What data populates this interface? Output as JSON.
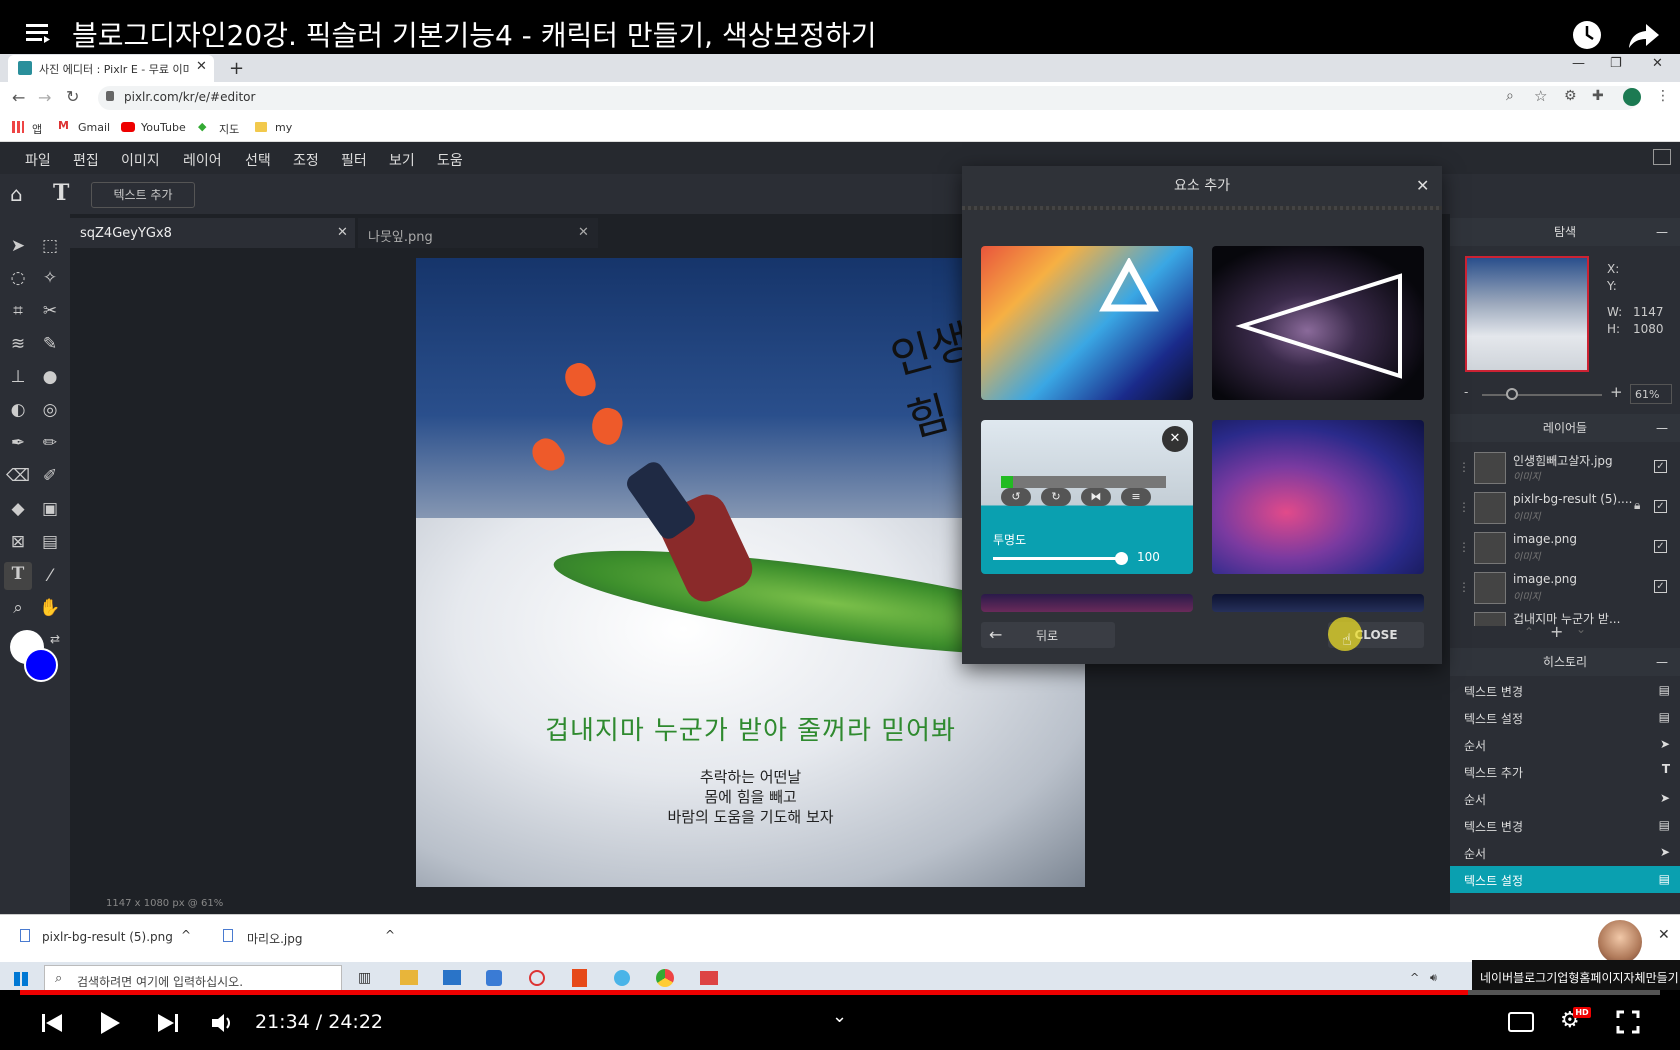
{
  "video": {
    "title": "블로그디자인20강. 픽슬러 기본기능4 - 캐릭터 만들기, 색상보정하기",
    "time": "21:34 / 24:22",
    "progress": 0.885
  },
  "browser": {
    "tab_title": "사진 에디터 : Pixlr E - 무료 이미",
    "url": "pixlr.com/kr/e/#editor",
    "bookmarks": [
      "앱",
      "Gmail",
      "YouTube",
      "지도",
      "my"
    ]
  },
  "pixlr": {
    "menu": [
      "파일",
      "편집",
      "이미지",
      "레이어",
      "선택",
      "조정",
      "필터",
      "보기",
      "도움"
    ],
    "toolbar_button": "텍스트 추가",
    "doc_tabs": [
      "sqZ4GeyYGx8",
      "나뭇잎.png"
    ],
    "status": "1147 x 1080 px @ 61%",
    "canvas_text": {
      "headline": "겁내지마 누군가 받아 줄꺼라 믿어봐",
      "lines": [
        "추락하는 어떤날",
        "몸에 힘을 빼고",
        "바람의 도움을 기도해 보자"
      ]
    }
  },
  "dialog": {
    "title": "요소 추가",
    "opacity_label": "투명도",
    "opacity_value": "100",
    "back_label": "뒤로",
    "close_label": "CLOSE"
  },
  "navigator": {
    "title": "탐색",
    "x_label": "X:",
    "y_label": "Y:",
    "w_label": "W:",
    "w_value": "1147",
    "h_label": "H:",
    "h_value": "1080",
    "zoom": "61%"
  },
  "layers": {
    "title": "레이어들",
    "items": [
      {
        "name": "인생힘빼고살자.jpg",
        "type": "이미지",
        "locked": false
      },
      {
        "name": "pixlr-bg-result (5)....",
        "type": "이미지",
        "locked": true
      },
      {
        "name": "image.png",
        "type": "이미지",
        "locked": false
      },
      {
        "name": "image.png",
        "type": "이미지",
        "locked": false
      },
      {
        "name": "겁내지마 누군가 받...",
        "type": "",
        "locked": false
      }
    ]
  },
  "history": {
    "title": "히스토리",
    "items": [
      "텍스트 변경",
      "텍스트 설정",
      "순서",
      "텍스트 추가",
      "순서",
      "텍스트 변경",
      "순서",
      "텍스트 설정"
    ],
    "active_index": 7
  },
  "downloads": [
    "pixlr-bg-result (5).png",
    "마리오.jpg"
  ],
  "taskbar": {
    "search_placeholder": "검색하려면 여기에 입력하십시오.",
    "notification": "네이버블로그기업형홈페이지자체만들기"
  },
  "colors": {
    "accent": "#0aa0b0",
    "foreground_swatch": "#ffffff",
    "background_swatch": "#0000ff"
  }
}
